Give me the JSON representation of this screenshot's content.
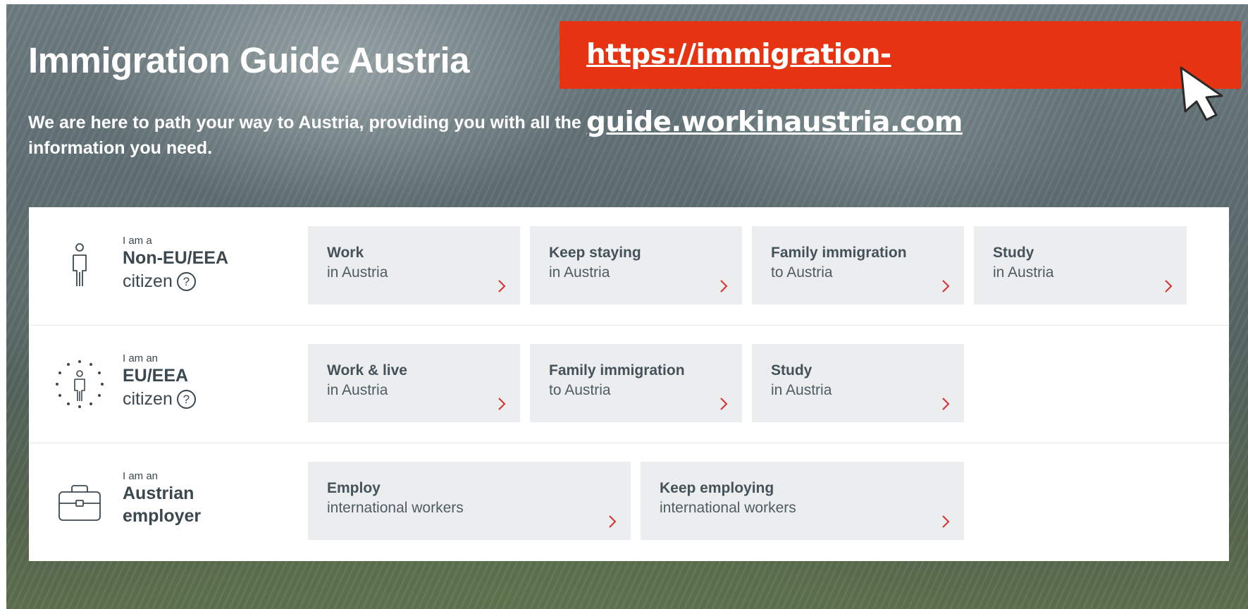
{
  "hero": {
    "title": "Immigration Guide Austria",
    "subtitle": "We are here to path your way to Austria, providing you with all the information you need."
  },
  "url_banner": {
    "text": "https://immigration-guide.workinaustria.com",
    "bg_color": "#e63312"
  },
  "colors": {
    "accent_arrow": "#d62f2f",
    "card_bg": "#ecedee",
    "text_dark": "#3b4850"
  },
  "rows": [
    {
      "icon": "person-icon",
      "prefix": "I am a",
      "main": "Non-EU/EEA",
      "suffix": "citizen",
      "help": "?",
      "cards": [
        {
          "title": "Work",
          "sub": "in Austria",
          "icon": "chevron-right-icon"
        },
        {
          "title": "Keep staying",
          "sub": "in Austria",
          "icon": "chevron-right-icon"
        },
        {
          "title": "Family immigration",
          "sub": "to Austria",
          "icon": "chevron-right-icon"
        },
        {
          "title": "Study",
          "sub": "in Austria",
          "icon": "chevron-right-icon"
        }
      ]
    },
    {
      "icon": "eu-person-icon",
      "prefix": "I am an",
      "main": "EU/EEA",
      "suffix": "citizen",
      "help": "?",
      "cards": [
        {
          "title": "Work & live",
          "sub": "in Austria",
          "icon": "chevron-right-icon"
        },
        {
          "title": "Family immigration",
          "sub": "to Austria",
          "icon": "chevron-right-icon"
        },
        {
          "title": "Study",
          "sub": "in Austria",
          "icon": "chevron-right-icon"
        }
      ]
    },
    {
      "icon": "briefcase-icon",
      "prefix": "I am an",
      "main": "Austrian",
      "suffix": "employer",
      "cards": [
        {
          "title": "Employ",
          "sub": "international workers",
          "icon": "chevron-right-icon"
        },
        {
          "title": "Keep employing",
          "sub": "international workers",
          "icon": "chevron-right-icon"
        }
      ]
    }
  ]
}
